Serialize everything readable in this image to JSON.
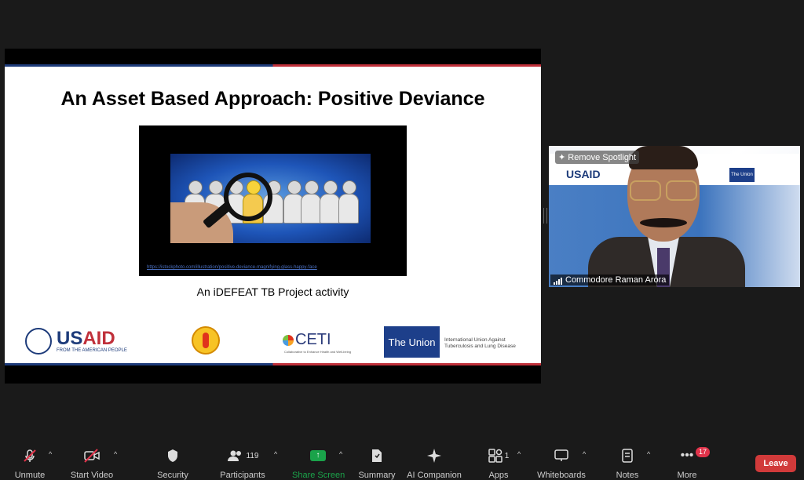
{
  "slide": {
    "title": "An Asset Based Approach: Positive Deviance",
    "image_url": "https://istockphoto.com/illustration/positive-deviance-magnifying-glass-happy-face",
    "caption": "An iDEFEAT TB Project activity",
    "logos": {
      "usaid_word_1": "US",
      "usaid_word_2": "AID",
      "usaid_sub": "FROM THE AMERICAN PEOPLE",
      "ceti_word": "CETI",
      "ceti_sub": "Collaborative to Enhance Health and Well-being",
      "union_box": "The Union",
      "union_text": "International Union Against Tuberculosis and Lung Disease"
    }
  },
  "video": {
    "spotlight_label": "Remove Spotlight",
    "participant_name": "Commodore Raman Arora",
    "banner_usaid": "USAID",
    "banner_union": "The Union"
  },
  "toolbar": {
    "unmute": "Unmute",
    "start_video": "Start Video",
    "security": "Security",
    "participants": "Participants",
    "participants_count": "119",
    "share_screen": "Share Screen",
    "summary": "Summary",
    "ai_companion": "AI Companion",
    "apps": "Apps",
    "apps_count": "1",
    "whiteboards": "Whiteboards",
    "notes": "Notes",
    "more": "More",
    "more_badge": "17",
    "leave": "Leave"
  },
  "colors": {
    "accent_green": "#1aa34a",
    "leave_red": "#d13a3a",
    "badge_red": "#e0334a",
    "usaid_blue": "#1d3b7a",
    "usaid_red": "#c0303a",
    "union_blue": "#1d3f8a"
  },
  "icons": {
    "unmute": "microphone-muted-icon",
    "start_video": "camera-off-icon",
    "security": "shield-icon",
    "participants": "people-icon",
    "share_screen": "share-arrow-icon",
    "summary": "document-icon",
    "ai_companion": "sparkle-icon",
    "apps": "apps-icon",
    "whiteboards": "whiteboard-icon",
    "notes": "notes-icon",
    "more": "ellipsis-icon"
  }
}
